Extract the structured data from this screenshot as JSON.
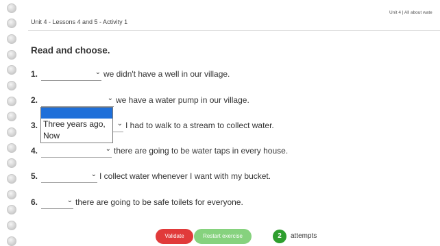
{
  "header": {
    "activity_title": "Unit 4 - Lessons 4 and 5 - Activity 1",
    "unit_title": "Unit 4 | All about wate"
  },
  "instruction": "Read and choose.",
  "items": [
    {
      "number": "1.",
      "selected": "",
      "text": "we didn't have a well in our village."
    },
    {
      "number": "2.",
      "selected": "",
      "text": "we have a water pump in our village."
    },
    {
      "number": "3.",
      "selected": "",
      "text": "I had to walk to a stream to collect water."
    },
    {
      "number": "4.",
      "selected": "",
      "text": "there are going to be water taps in every house."
    },
    {
      "number": "5.",
      "selected": "",
      "text": "I collect water whenever I want with my bucket."
    },
    {
      "number": "6.",
      "selected": "",
      "text": "there are going to be safe toilets for everyone."
    }
  ],
  "open_dropdown": {
    "options": [
      "",
      "Three years ago,",
      "Now"
    ]
  },
  "buttons": {
    "validate": "Validate",
    "restart": "Restart exercise"
  },
  "attempts": {
    "count": "2",
    "label": "attempts"
  },
  "colors": {
    "validate": "#e13a3a",
    "restart": "#86d27e",
    "attempts_badge": "#2e9e2e",
    "dropdown_highlight": "#1e6fd9"
  },
  "icons": {
    "select_arrow": "chevron-down-icon",
    "binding": "notebook-ring-icon"
  }
}
